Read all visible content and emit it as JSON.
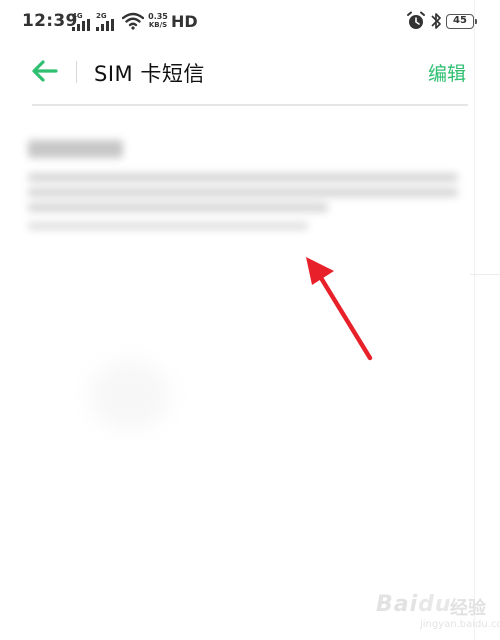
{
  "status_bar": {
    "time": "12:39",
    "sim1_gen": "4G",
    "sim2_gen": "2G",
    "speed_value": "0.35",
    "speed_unit": "KB/S",
    "hd_label": "HD",
    "battery": "45",
    "icons": [
      "signal-icon",
      "wifi-icon",
      "alarm-icon",
      "bluetooth-icon",
      "battery-icon"
    ]
  },
  "header": {
    "title": "SIM 卡短信",
    "edit_label": "编辑",
    "back_icon": "arrow-left-icon"
  },
  "message": {
    "title": "",
    "body": "",
    "time": ""
  },
  "watermark": {
    "logo": "Bai",
    "paw": "du",
    "text": "经验",
    "url": "jingyan.baidu.com"
  },
  "colors": {
    "accent": "#2fbf71",
    "arrow": "#e8202a",
    "divider": "#e6e6e6"
  }
}
